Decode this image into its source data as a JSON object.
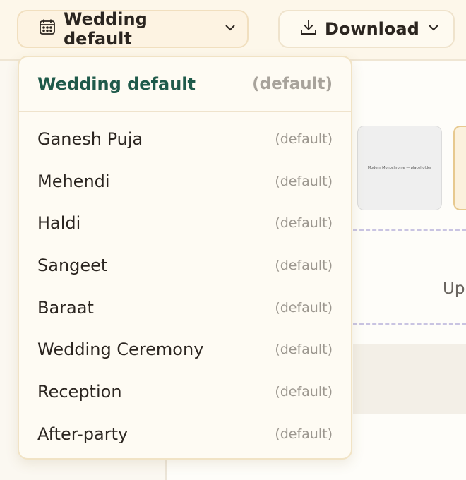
{
  "toolbar": {
    "event_selector_label": "Wedding default",
    "download_label": "Download"
  },
  "background": {
    "thumbnail_caption": "Modern Monochrome — placeholder",
    "partial_text": "Up"
  },
  "dropdown": {
    "current": {
      "name": "Wedding default",
      "tag": "(default)"
    },
    "items": [
      {
        "name": "Ganesh Puja",
        "tag": "(default)"
      },
      {
        "name": "Mehendi",
        "tag": "(default)"
      },
      {
        "name": "Haldi",
        "tag": "(default)"
      },
      {
        "name": "Sangeet",
        "tag": "(default)"
      },
      {
        "name": "Baraat",
        "tag": "(default)"
      },
      {
        "name": "Wedding Ceremony",
        "tag": "(default)"
      },
      {
        "name": "Reception",
        "tag": "(default)"
      },
      {
        "name": "After-party",
        "tag": "(default)"
      }
    ]
  },
  "colors": {
    "accent_green": "#1f5a4a",
    "button_bg": "#fdf3e2",
    "border": "#f1dfbf"
  },
  "icons": {
    "event": "calendar-icon",
    "download": "download-icon",
    "chevron": "chevron-down-icon"
  }
}
